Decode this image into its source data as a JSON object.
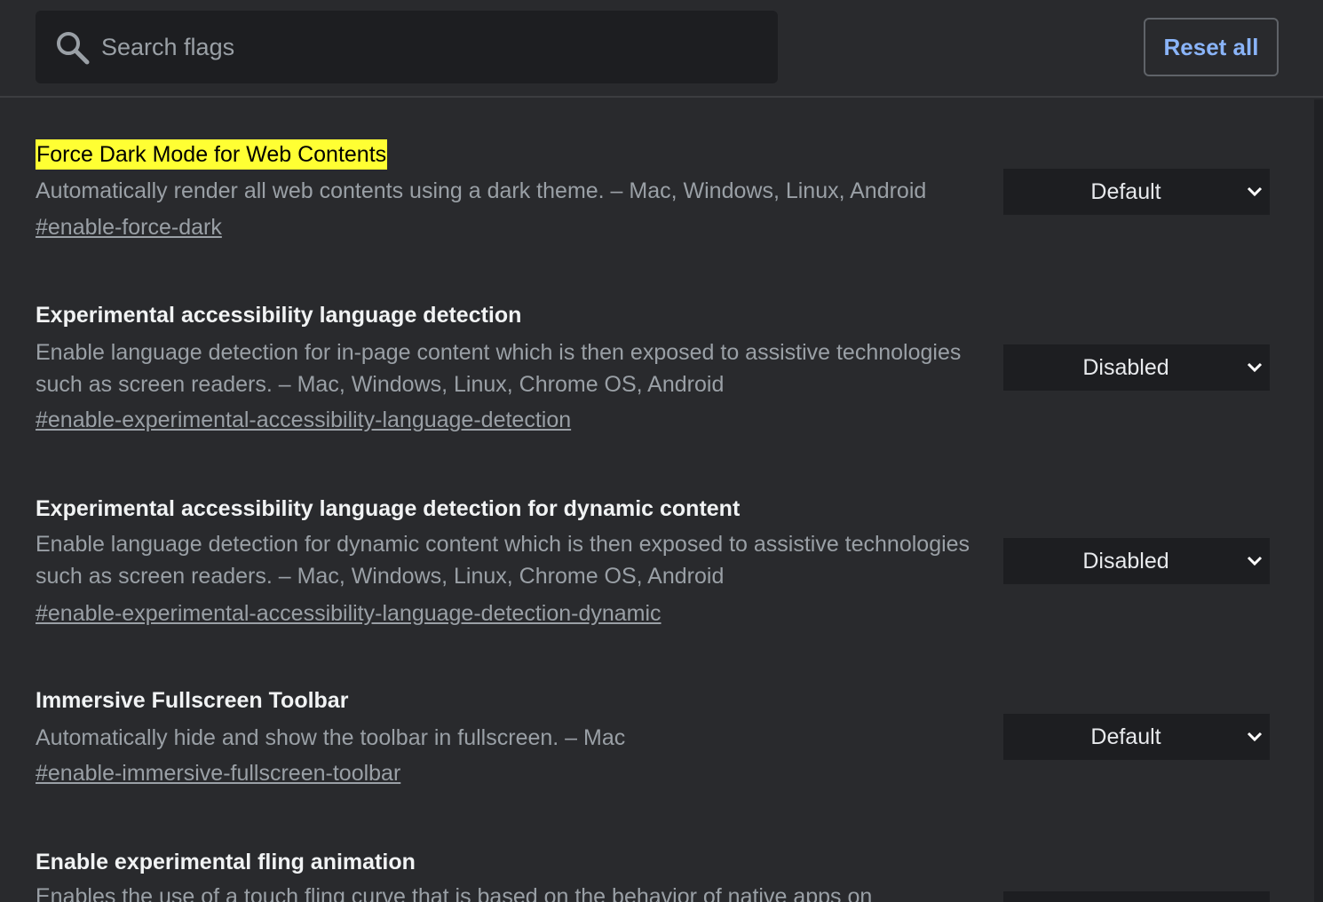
{
  "search": {
    "placeholder": "Search flags",
    "value": ""
  },
  "reset_label": "Reset all",
  "flags": [
    {
      "title": "Force Dark Mode for Web Contents",
      "highlighted": true,
      "description": "Automatically render all web contents using a dark theme. – Mac, Windows, Linux, Android",
      "link": "#enable-force-dark",
      "state": "Default"
    },
    {
      "title": "Experimental accessibility language detection",
      "description": "Enable language detection for in-page content which is then exposed to assistive technologies such as screen readers. – Mac, Windows, Linux, Chrome OS, Android",
      "link": "#enable-experimental-accessibility-language-detection",
      "state": "Disabled"
    },
    {
      "title": "Experimental accessibility language detection for dynamic content",
      "description": "Enable language detection for dynamic content which is then exposed to assistive technologies such as screen readers. – Mac, Windows, Linux, Chrome OS, Android",
      "link": "#enable-experimental-accessibility-language-detection-dynamic",
      "state": "Disabled"
    },
    {
      "title": "Immersive Fullscreen Toolbar",
      "description": "Automatically hide and show the toolbar in fullscreen. – Mac",
      "link": "#enable-immersive-fullscreen-toolbar",
      "state": "Default"
    },
    {
      "title": "Enable experimental fling animation",
      "description": "Enables the use of a touch fling curve that is based on the behavior of native apps on"
    }
  ],
  "colors": {
    "background": "#292a2d",
    "highlight": "#ffff33",
    "accent": "#8ab4f8",
    "secondary_text": "#9aa0a6"
  },
  "icons": [
    "search-icon",
    "chevron-down-icon"
  ]
}
